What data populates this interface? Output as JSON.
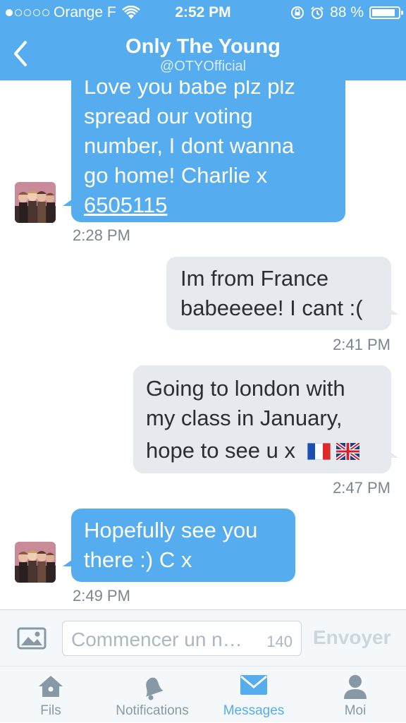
{
  "status_bar": {
    "carrier": "Orange F",
    "time": "2:52 PM",
    "battery": "88 %",
    "battery_level": 0.88,
    "signal_bars": 1
  },
  "header": {
    "title": "Only The Young",
    "handle": "@OTYOfficial"
  },
  "messages": [
    {
      "direction": "incoming",
      "lines": [
        "Love you babe  plz plz",
        "spread our voting",
        "number, I dont wanna",
        "go home! Charlie x"
      ],
      "link": "6505115",
      "time": "2:28 PM"
    },
    {
      "direction": "outgoing",
      "lines": [
        "Im from France",
        "babeeeee! I cant :("
      ],
      "time": "2:41 PM"
    },
    {
      "direction": "outgoing",
      "lines": [
        "Going to london with",
        "my class in January,",
        "hope to see u x"
      ],
      "emoji": [
        "french-flag",
        "uk-flag"
      ],
      "time": "2:47 PM"
    },
    {
      "direction": "incoming",
      "lines": [
        "Hopefully see you",
        "there :) C x"
      ],
      "time": "2:49 PM"
    }
  ],
  "composer": {
    "placeholder": "Commencer un n…",
    "char_count": "140",
    "send_label": "Envoyer"
  },
  "tabs": [
    {
      "label": "Fils",
      "icon": "home-icon",
      "active": false
    },
    {
      "label": "Notifications",
      "icon": "bell-icon",
      "active": false
    },
    {
      "label": "Messages",
      "icon": "envelope-icon",
      "active": true
    },
    {
      "label": "Moi",
      "icon": "person-icon",
      "active": false
    }
  ],
  "colors": {
    "accent": "#55acee",
    "incoming_bubble": "#55acee",
    "outgoing_bubble": "#e6e9ed",
    "timestamp": "#7a8691"
  }
}
